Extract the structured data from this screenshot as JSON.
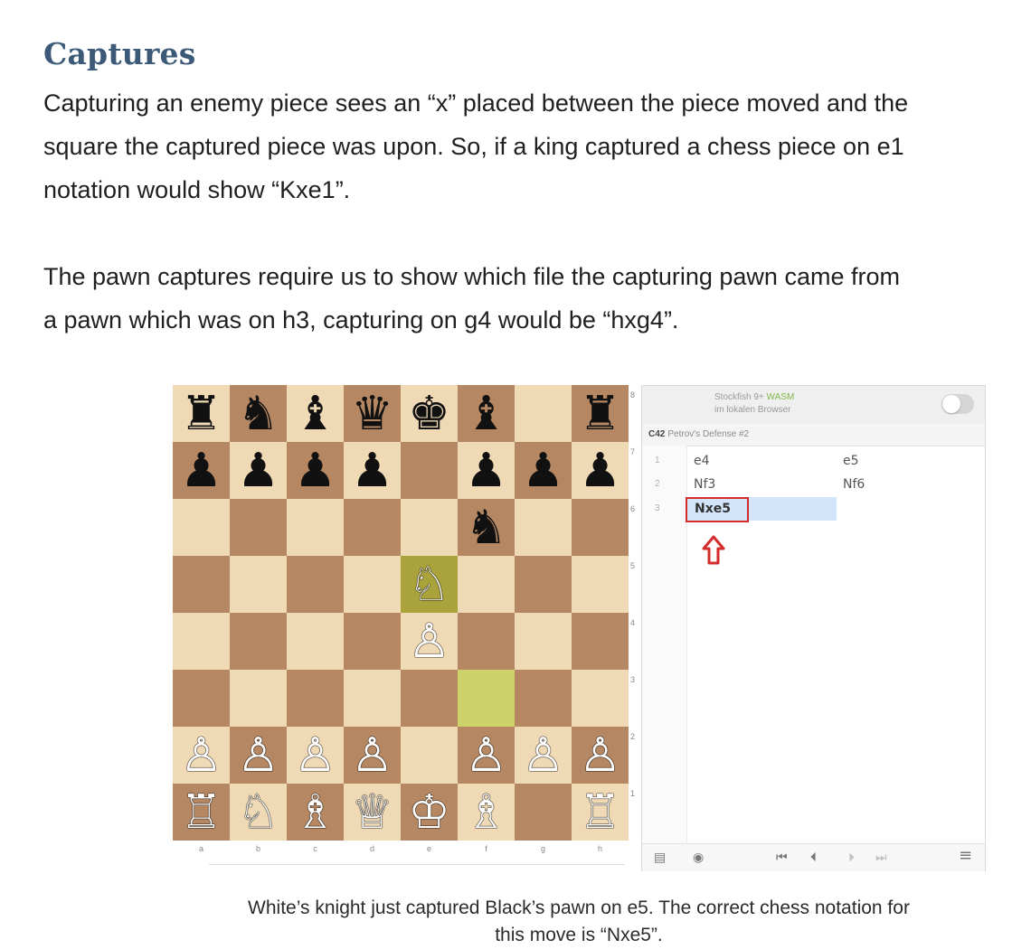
{
  "heading": "Captures",
  "paragraphs": {
    "p1": [
      "Capturing an enemy piece sees an “x” placed between the piece moved and the",
      "square the captured piece was upon. So, if a king captured a chess piece on e1",
      "notation would show “Kxe1”."
    ],
    "p2": [
      "The pawn captures require us to show which file the capturing pawn came from",
      "a pawn which was on h3, capturing on g4 would be “hxg4”."
    ]
  },
  "board": {
    "files": [
      "a",
      "b",
      "c",
      "d",
      "e",
      "f",
      "g",
      "h"
    ],
    "ranks": [
      "8",
      "7",
      "6",
      "5",
      "4",
      "3",
      "2",
      "1"
    ],
    "position": [
      [
        "♜",
        "♞",
        "♝",
        "♛",
        "♚",
        "♝",
        "",
        "♜"
      ],
      [
        "♟",
        "♟",
        "♟",
        "♟",
        "",
        "♟",
        "♟",
        "♟"
      ],
      [
        "",
        "",
        "",
        "",
        "",
        "♞",
        "",
        ""
      ],
      [
        "",
        "",
        "",
        "",
        "♘",
        "",
        "",
        ""
      ],
      [
        "",
        "",
        "",
        "",
        "♙",
        "",
        "",
        ""
      ],
      [
        "",
        "",
        "",
        "",
        "",
        "",
        "",
        ""
      ],
      [
        "♙",
        "♙",
        "♙",
        "♙",
        "",
        "♙",
        "♙",
        "♙"
      ],
      [
        "♖",
        "♘",
        "♗",
        "♕",
        "♔",
        "♗",
        "",
        "♖"
      ]
    ],
    "last_move": {
      "from": "f3",
      "to": "e5"
    },
    "colors": {
      "light": "#f0d9b5",
      "dark": "#b58863",
      "highlight_from": "#cdd26a",
      "highlight_to": "#aaa23a"
    }
  },
  "panel": {
    "engine_name": "Stockfish 9+",
    "engine_tag": "WASM",
    "engine_sub": "im lokalen Browser",
    "opening_eco": "C42",
    "opening_name": "Petrov's Defense #2",
    "moves": [
      {
        "num": "1",
        "white": "e4",
        "black": "e5"
      },
      {
        "num": "2",
        "white": "Nf3",
        "black": "Nf6"
      }
    ],
    "current_move": {
      "num": "3",
      "san": "Nxe5"
    },
    "controls": {
      "book_icon": "▤",
      "target_icon": "◉",
      "first_icon": "⏮",
      "prev_icon": "⏴",
      "next_icon": "⏵",
      "last_icon": "⏭",
      "menu_icon": "≡"
    }
  },
  "caption": [
    "White’s knight just captured Black’s pawn on e5. The correct chess notation for",
    "this move is “Nxe5”."
  ],
  "colors": {
    "heading": "#3c5a78",
    "highlight_box": "#d62b2b",
    "arrow": "#d62b2b"
  }
}
